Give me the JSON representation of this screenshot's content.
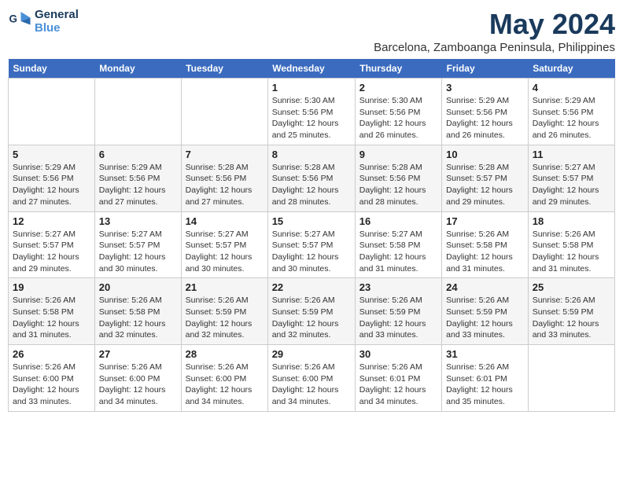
{
  "logo": {
    "line1": "General",
    "line2": "Blue"
  },
  "title": {
    "month_year": "May 2024",
    "location": "Barcelona, Zamboanga Peninsula, Philippines"
  },
  "days_of_week": [
    "Sunday",
    "Monday",
    "Tuesday",
    "Wednesday",
    "Thursday",
    "Friday",
    "Saturday"
  ],
  "weeks": [
    [
      {
        "day": "",
        "info": ""
      },
      {
        "day": "",
        "info": ""
      },
      {
        "day": "",
        "info": ""
      },
      {
        "day": "1",
        "info": "Sunrise: 5:30 AM\nSunset: 5:56 PM\nDaylight: 12 hours\nand 25 minutes."
      },
      {
        "day": "2",
        "info": "Sunrise: 5:30 AM\nSunset: 5:56 PM\nDaylight: 12 hours\nand 26 minutes."
      },
      {
        "day": "3",
        "info": "Sunrise: 5:29 AM\nSunset: 5:56 PM\nDaylight: 12 hours\nand 26 minutes."
      },
      {
        "day": "4",
        "info": "Sunrise: 5:29 AM\nSunset: 5:56 PM\nDaylight: 12 hours\nand 26 minutes."
      }
    ],
    [
      {
        "day": "5",
        "info": "Sunrise: 5:29 AM\nSunset: 5:56 PM\nDaylight: 12 hours\nand 27 minutes."
      },
      {
        "day": "6",
        "info": "Sunrise: 5:29 AM\nSunset: 5:56 PM\nDaylight: 12 hours\nand 27 minutes."
      },
      {
        "day": "7",
        "info": "Sunrise: 5:28 AM\nSunset: 5:56 PM\nDaylight: 12 hours\nand 27 minutes."
      },
      {
        "day": "8",
        "info": "Sunrise: 5:28 AM\nSunset: 5:56 PM\nDaylight: 12 hours\nand 28 minutes."
      },
      {
        "day": "9",
        "info": "Sunrise: 5:28 AM\nSunset: 5:56 PM\nDaylight: 12 hours\nand 28 minutes."
      },
      {
        "day": "10",
        "info": "Sunrise: 5:28 AM\nSunset: 5:57 PM\nDaylight: 12 hours\nand 29 minutes."
      },
      {
        "day": "11",
        "info": "Sunrise: 5:27 AM\nSunset: 5:57 PM\nDaylight: 12 hours\nand 29 minutes."
      }
    ],
    [
      {
        "day": "12",
        "info": "Sunrise: 5:27 AM\nSunset: 5:57 PM\nDaylight: 12 hours\nand 29 minutes."
      },
      {
        "day": "13",
        "info": "Sunrise: 5:27 AM\nSunset: 5:57 PM\nDaylight: 12 hours\nand 30 minutes."
      },
      {
        "day": "14",
        "info": "Sunrise: 5:27 AM\nSunset: 5:57 PM\nDaylight: 12 hours\nand 30 minutes."
      },
      {
        "day": "15",
        "info": "Sunrise: 5:27 AM\nSunset: 5:57 PM\nDaylight: 12 hours\nand 30 minutes."
      },
      {
        "day": "16",
        "info": "Sunrise: 5:27 AM\nSunset: 5:58 PM\nDaylight: 12 hours\nand 31 minutes."
      },
      {
        "day": "17",
        "info": "Sunrise: 5:26 AM\nSunset: 5:58 PM\nDaylight: 12 hours\nand 31 minutes."
      },
      {
        "day": "18",
        "info": "Sunrise: 5:26 AM\nSunset: 5:58 PM\nDaylight: 12 hours\nand 31 minutes."
      }
    ],
    [
      {
        "day": "19",
        "info": "Sunrise: 5:26 AM\nSunset: 5:58 PM\nDaylight: 12 hours\nand 31 minutes."
      },
      {
        "day": "20",
        "info": "Sunrise: 5:26 AM\nSunset: 5:58 PM\nDaylight: 12 hours\nand 32 minutes."
      },
      {
        "day": "21",
        "info": "Sunrise: 5:26 AM\nSunset: 5:59 PM\nDaylight: 12 hours\nand 32 minutes."
      },
      {
        "day": "22",
        "info": "Sunrise: 5:26 AM\nSunset: 5:59 PM\nDaylight: 12 hours\nand 32 minutes."
      },
      {
        "day": "23",
        "info": "Sunrise: 5:26 AM\nSunset: 5:59 PM\nDaylight: 12 hours\nand 33 minutes."
      },
      {
        "day": "24",
        "info": "Sunrise: 5:26 AM\nSunset: 5:59 PM\nDaylight: 12 hours\nand 33 minutes."
      },
      {
        "day": "25",
        "info": "Sunrise: 5:26 AM\nSunset: 5:59 PM\nDaylight: 12 hours\nand 33 minutes."
      }
    ],
    [
      {
        "day": "26",
        "info": "Sunrise: 5:26 AM\nSunset: 6:00 PM\nDaylight: 12 hours\nand 33 minutes."
      },
      {
        "day": "27",
        "info": "Sunrise: 5:26 AM\nSunset: 6:00 PM\nDaylight: 12 hours\nand 34 minutes."
      },
      {
        "day": "28",
        "info": "Sunrise: 5:26 AM\nSunset: 6:00 PM\nDaylight: 12 hours\nand 34 minutes."
      },
      {
        "day": "29",
        "info": "Sunrise: 5:26 AM\nSunset: 6:00 PM\nDaylight: 12 hours\nand 34 minutes."
      },
      {
        "day": "30",
        "info": "Sunrise: 5:26 AM\nSunset: 6:01 PM\nDaylight: 12 hours\nand 34 minutes."
      },
      {
        "day": "31",
        "info": "Sunrise: 5:26 AM\nSunset: 6:01 PM\nDaylight: 12 hours\nand 35 minutes."
      },
      {
        "day": "",
        "info": ""
      }
    ]
  ]
}
